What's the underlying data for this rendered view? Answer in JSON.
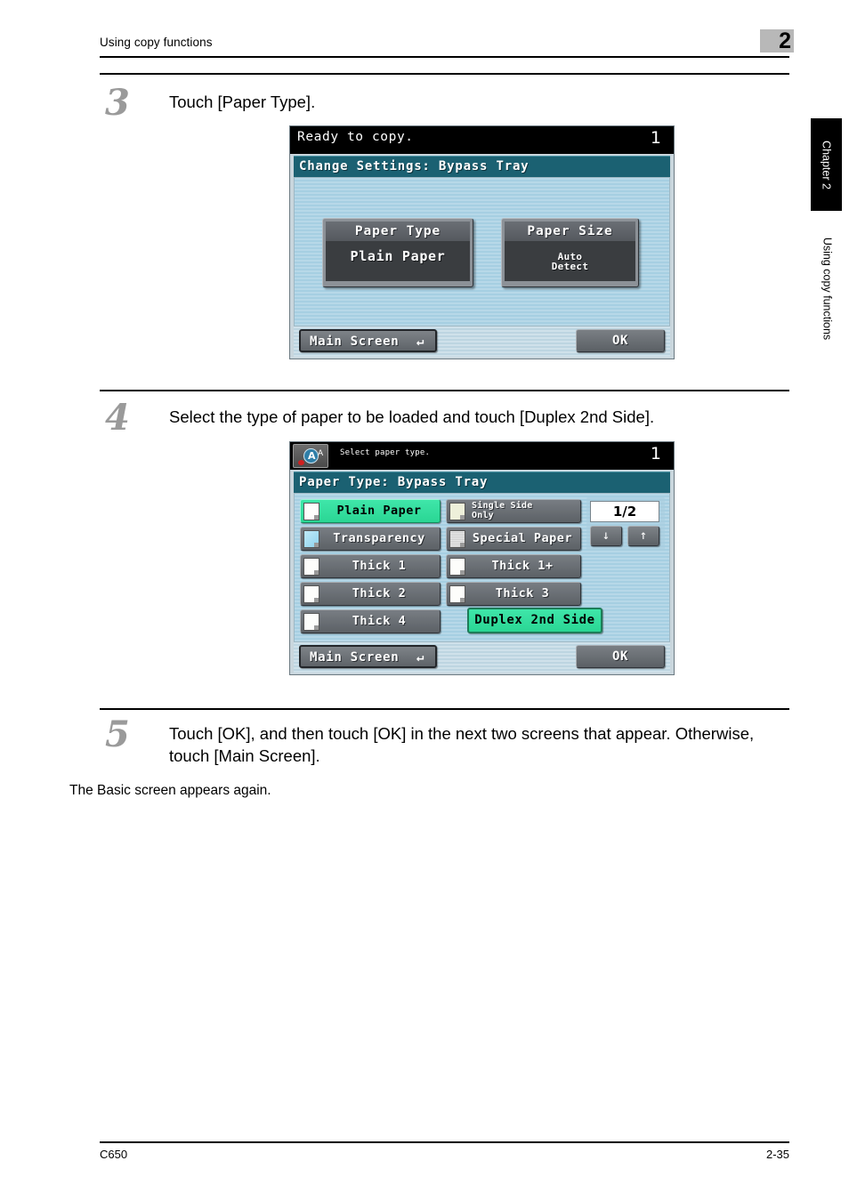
{
  "header": {
    "title": "Using copy functions",
    "chapter_number": "2"
  },
  "sidebar": {
    "tab_label": "Chapter 2",
    "caption_label": "Using copy functions"
  },
  "steps": [
    {
      "number": "3",
      "text": "Touch [Paper Type]."
    },
    {
      "number": "4",
      "text": "Select the type of paper to be loaded and touch [Duplex 2nd Side]."
    },
    {
      "number": "5",
      "text": "Touch [OK], and then touch [OK] in the next two screens that appear. Otherwise, touch [Main Screen].",
      "sub": "The Basic screen appears again."
    }
  ],
  "screen1": {
    "status_text": "Ready to copy.",
    "copy_count": "1",
    "title": "Change Settings: Bypass Tray",
    "paper_type_button": {
      "head": "Paper Type",
      "value": "Plain Paper"
    },
    "paper_size_button": {
      "head": "Paper Size",
      "value_line1": "Auto",
      "value_line2": "Detect"
    },
    "main_screen_label": "Main Screen",
    "ok_label": "OK"
  },
  "screen2": {
    "status_text": "Select paper type.",
    "copy_count": "1",
    "title": "Paper Type: Bypass Tray",
    "left_column": [
      {
        "label": "Plain Paper",
        "selected": true,
        "icon": "plain-sheet-icon"
      },
      {
        "label": "Transparency",
        "selected": false,
        "icon": "transparency-sheet-icon"
      },
      {
        "label": "Thick 1",
        "selected": false,
        "icon": "plain-sheet-icon"
      },
      {
        "label": "Thick 2",
        "selected": false,
        "icon": "plain-sheet-icon"
      },
      {
        "label": "Thick 4",
        "selected": false,
        "icon": "plain-sheet-icon"
      }
    ],
    "right_column": [
      {
        "label": "Single Side\nOnly",
        "selected": false,
        "icon": "cream-sheet-icon",
        "two_line": true
      },
      {
        "label": "Special Paper",
        "selected": false,
        "icon": "special-sheet-icon"
      },
      {
        "label": "Thick 1+",
        "selected": false,
        "icon": "plain-sheet-icon"
      },
      {
        "label": "Thick 3",
        "selected": false,
        "icon": "plain-sheet-icon"
      }
    ],
    "duplex_label": "Duplex 2nd Side",
    "pager": {
      "value": "1/2",
      "down_arrow": "↓",
      "up_arrow": "↑"
    },
    "main_screen_label": "Main Screen",
    "ok_label": "OK"
  },
  "footer": {
    "left": "C650",
    "right": "2-35"
  },
  "colors": {
    "accent_green": "#2ad694",
    "title_teal": "#1b6172",
    "lcd_blue": "#b7d8e8",
    "chapter_gray": "#b8b8b8",
    "step_num_gray": "#9a9a9a"
  }
}
